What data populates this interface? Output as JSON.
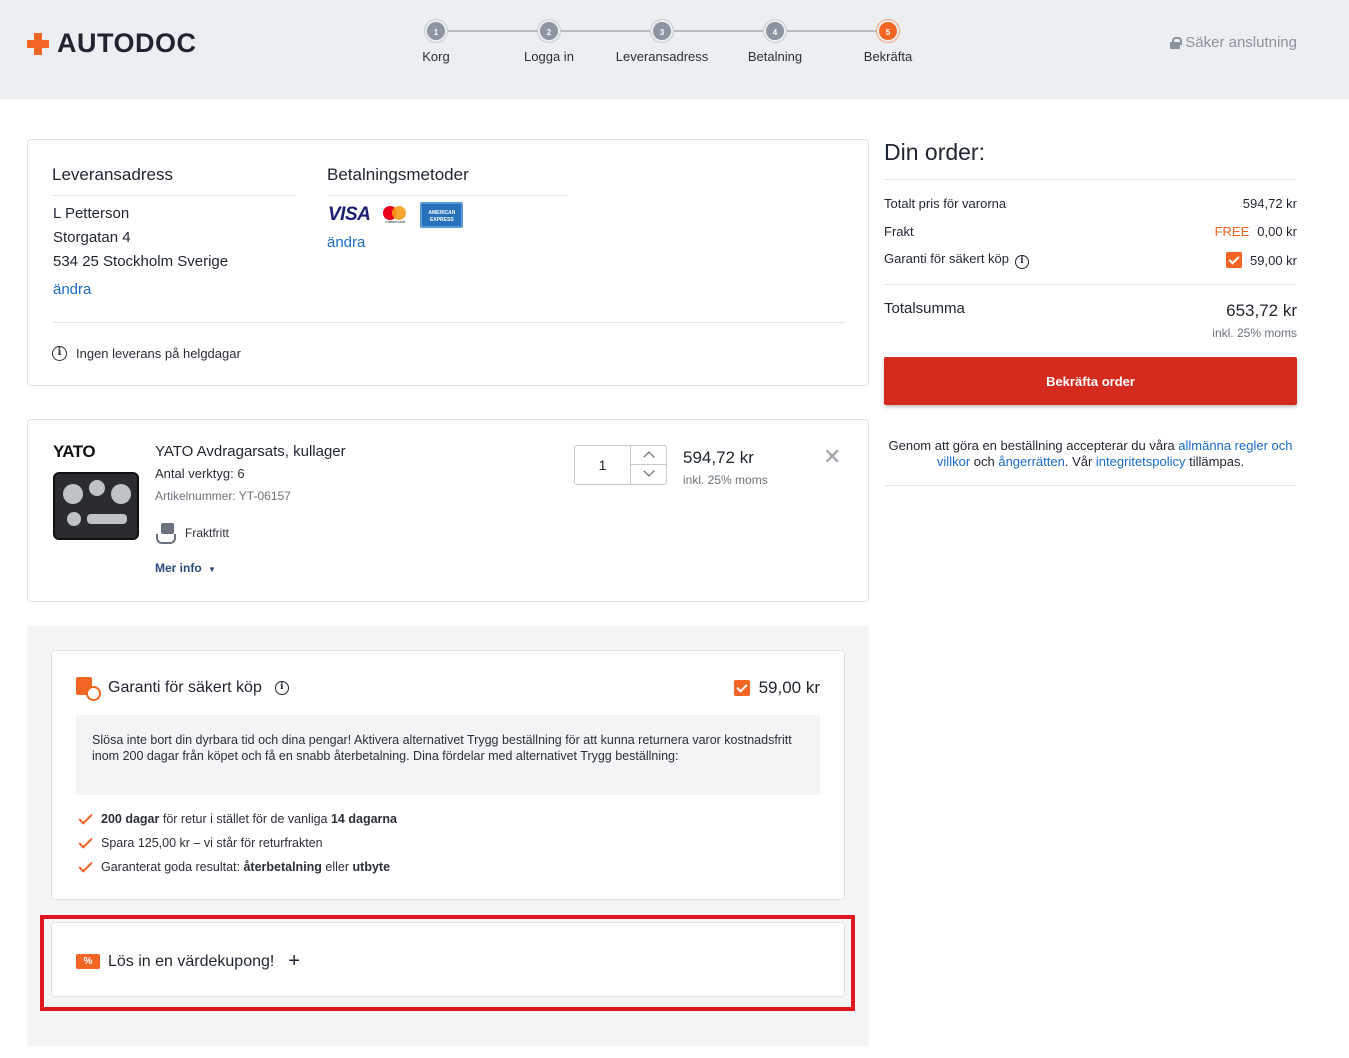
{
  "header": {
    "logo_text": "AUTODOC",
    "secure_label": "Säker anslutning",
    "steps": [
      {
        "num": "1",
        "label": "Korg"
      },
      {
        "num": "2",
        "label": "Logga in"
      },
      {
        "num": "3",
        "label": "Leveransadress"
      },
      {
        "num": "4",
        "label": "Betalning"
      },
      {
        "num": "5",
        "label": "Bekräfta"
      }
    ],
    "active_step": 5
  },
  "address": {
    "title": "Leveransadress",
    "name": "L Petterson",
    "street": "Storgatan 4",
    "city": "534 25 Stockholm Sverige",
    "edit_label": "ändra",
    "notice": "Ingen leverans på helgdagar"
  },
  "payment": {
    "title": "Betalningsmetoder",
    "visa": "VISA",
    "mastercard_caption": "mastercard",
    "amex": "AMERICAN EXPRESS",
    "edit_label": "ändra"
  },
  "product": {
    "brand": "YATO",
    "title": "YATO Avdragarsats, kullager",
    "tools_count": "Antal verktyg: 6",
    "article": "Artikelnummer: YT-06157",
    "shipping": "Fraktfritt",
    "more_info": "Mer info",
    "quantity": "1",
    "price": "594,72 kr",
    "price_note": "inkl. 25% moms"
  },
  "guarantee": {
    "title": "Garanti för säkert köp",
    "price": "59,00 kr",
    "description": "Slösa inte bort din dyrbara tid och dina pengar! Aktivera alternativet Trygg beställning för att kunna returnera varor kostnadsfritt inom 200 dagar från köpet och få en snabb återbetalning. Dina fördelar med alternativet Trygg beställning:",
    "benefits": [
      {
        "bold1": "200 dagar",
        "text1": " för retur i stället för de vanliga ",
        "bold2": "14 dagarna",
        "text2": ""
      },
      {
        "bold1": "",
        "text1": "Spara 125,00 kr – vi står för returfrakten",
        "bold2": "",
        "text2": ""
      },
      {
        "bold1": "",
        "text1": "Garanterat goda resultat: ",
        "bold2": "återbetalning",
        "text2": " eller ",
        "bold3": "utbyte"
      }
    ]
  },
  "coupon": {
    "label": "Lös in en värdekupong!",
    "icon_text": "%",
    "plus": "+"
  },
  "order": {
    "title": "Din order:",
    "items_label": "Totalt pris för varorna",
    "items_value": "594,72 kr",
    "shipping_label": "Frakt",
    "shipping_free": "FREE",
    "shipping_value": "0,00 kr",
    "guarantee_label": "Garanti för säkert köp",
    "guarantee_value": "59,00 kr",
    "total_label": "Totalsumma",
    "total_value": "653,72 kr",
    "total_note": "inkl. 25% moms",
    "confirm_label": "Bekräfta order",
    "terms_pre": "Genom att göra en beställning accepterar du våra ",
    "terms_link1": "allmänna regler och villkor",
    "terms_mid1": " och ",
    "terms_link2": "ångerrätten",
    "terms_mid2": ". Vår ",
    "terms_link3": "integritetspolicy",
    "terms_post": " tillämpas."
  },
  "colors": {
    "accent": "#f26522",
    "confirm": "#d52b1e",
    "link": "#1a6bc7",
    "highlight": "#e0161f"
  }
}
